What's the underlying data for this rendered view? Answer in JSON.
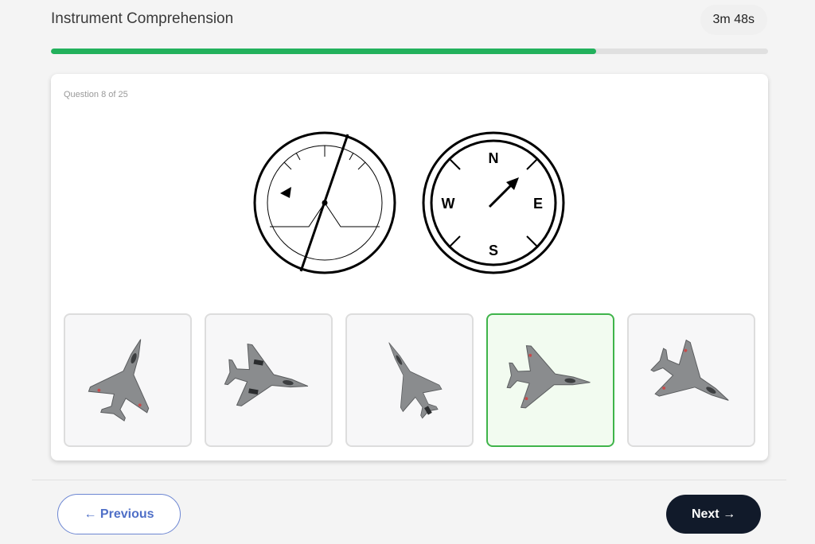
{
  "header": {
    "title": "Instrument Comprehension",
    "timer": "3m 48s"
  },
  "progress": {
    "fraction": 0.76
  },
  "question": {
    "label": "Question 8 of 25"
  },
  "compass": {
    "n": "N",
    "e": "E",
    "s": "S",
    "w": "W"
  },
  "options": {
    "selected_index": 3,
    "count": 5
  },
  "nav": {
    "previous_label": "← Previous",
    "next_label": "Next →"
  },
  "colors": {
    "accent_green": "#22b15c",
    "selected_border": "#3fb44a",
    "next_button": "#111a2a",
    "prev_border": "#6c86d2"
  }
}
